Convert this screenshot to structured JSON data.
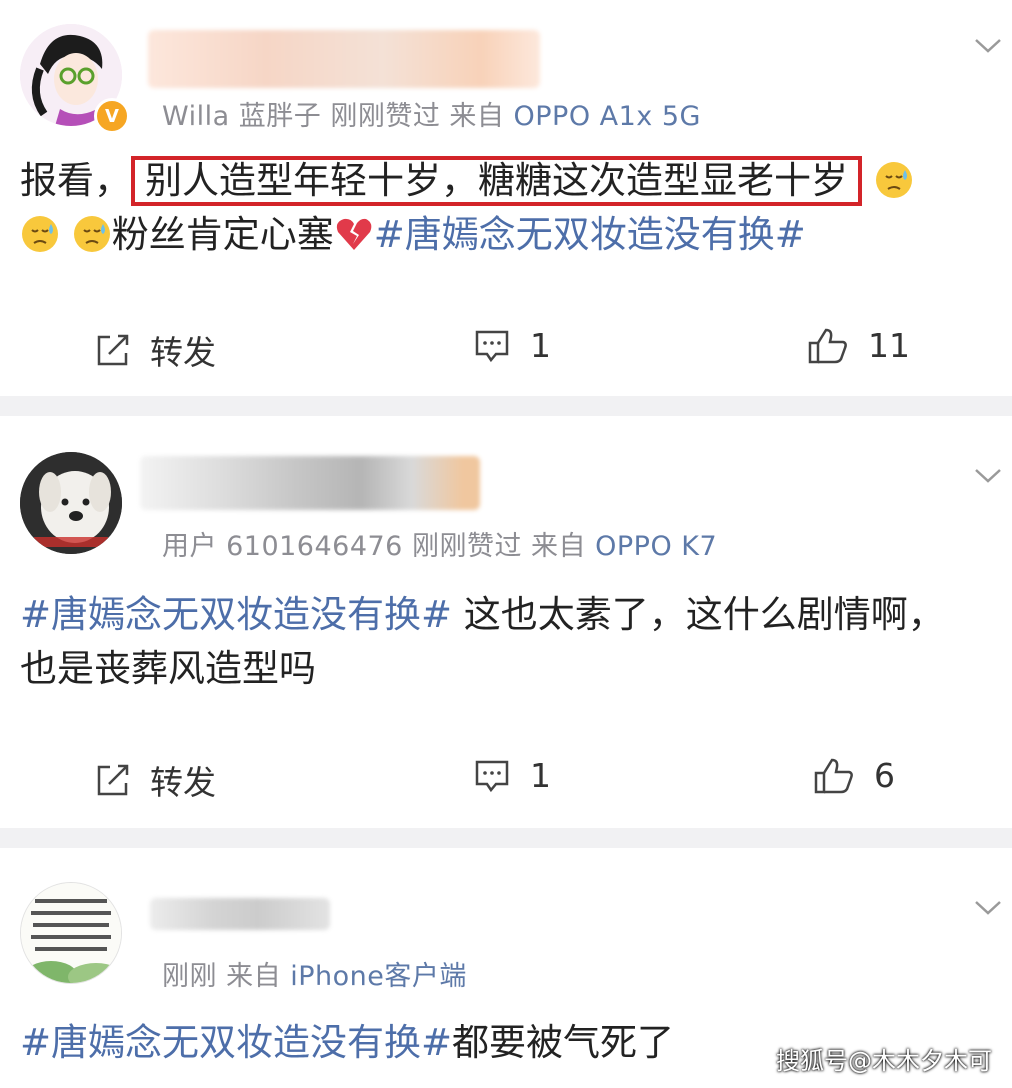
{
  "posts": [
    {
      "meta": {
        "prefix": "Willa 蓝胖子  刚刚赞过  来自",
        "device": "OPPO A1x 5G"
      },
      "body": {
        "lead": "报看，",
        "highlight": "别人造型年轻十岁，糖糖这次造型显老十岁",
        "line2_text": "粉丝肯定心塞",
        "hashtag": "#唐嫣念无双妆造没有换#"
      },
      "actions": {
        "repost_label": "转发",
        "comment_count": "1",
        "like_count": "11"
      },
      "avatar_icon": "cartoon-avatar",
      "badge_icon": "v-badge",
      "badge_text": "V"
    },
    {
      "meta": {
        "prefix": "用户 6101646476  刚刚赞过  来自",
        "device": "OPPO K7"
      },
      "body": {
        "hashtag": "#唐嫣念无双妆造没有换#",
        "text": " 这也太素了，这什么剧情啊，也是丧葬风造型吗"
      },
      "actions": {
        "repost_label": "转发",
        "comment_count": "1",
        "like_count": "6"
      },
      "avatar_icon": "dog-avatar"
    },
    {
      "meta": {
        "prefix": "刚刚  来自",
        "device": "iPhone客户端"
      },
      "body": {
        "hashtag": "#唐嫣念无双妆造没有换#",
        "text": "都要被气死了"
      },
      "avatar_icon": "text-image-avatar"
    }
  ],
  "watermark": "搜狐号@木木夕木可",
  "colors": {
    "link": "#4d6ea9",
    "highlight_border": "#d32429",
    "separator": "#f1f1f3"
  }
}
